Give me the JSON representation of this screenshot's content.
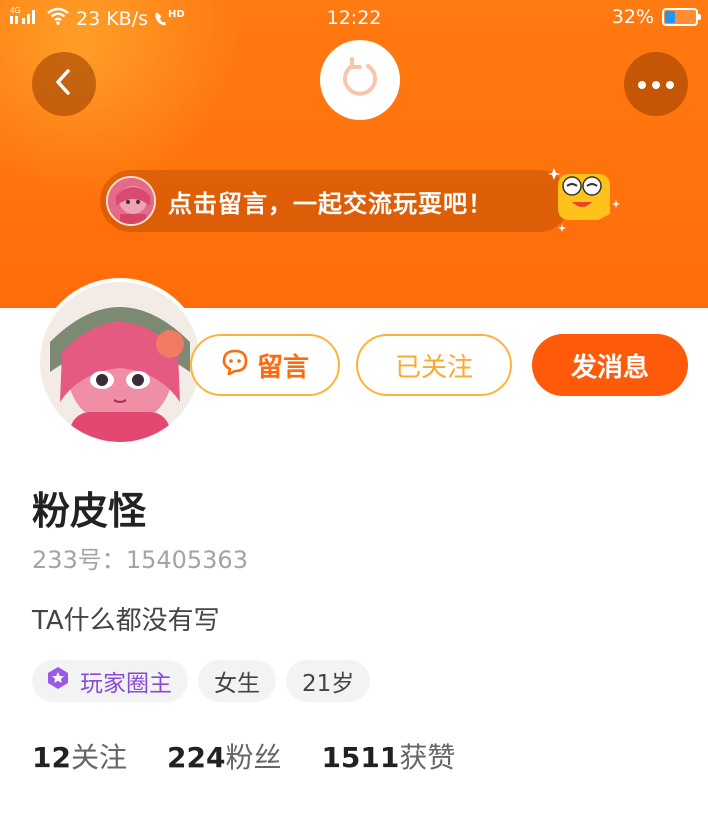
{
  "status_bar": {
    "network": "4G",
    "speed": "23 KB/s",
    "hd": "HD",
    "time": "12:22",
    "battery": "32%",
    "battery_level": 0.32
  },
  "header": {
    "back_icon": "chevron-left-icon",
    "refresh_icon": "refresh-icon",
    "more_icon": "more-icon"
  },
  "banner": {
    "text": "点击留言，一起交流玩耍吧！"
  },
  "actions": {
    "message_label": "留言",
    "follow_label": "已关注",
    "send_label": "发消息"
  },
  "profile": {
    "name": "粉皮怪",
    "id_label": "233号：",
    "id_value": "15405363",
    "bio": "TA什么都没有写",
    "tags": [
      "玩家圈主",
      "女生",
      "21岁"
    ]
  },
  "stats": [
    {
      "num": "12",
      "label": "关注"
    },
    {
      "num": "224",
      "label": "粉丝"
    },
    {
      "num": "1511",
      "label": "获赞"
    }
  ],
  "colors": {
    "brand_orange": "#ff6d0a",
    "accent_button": "#ff5a0a",
    "outline": "#ffb23a",
    "role_purple": "#8a4ad8"
  }
}
